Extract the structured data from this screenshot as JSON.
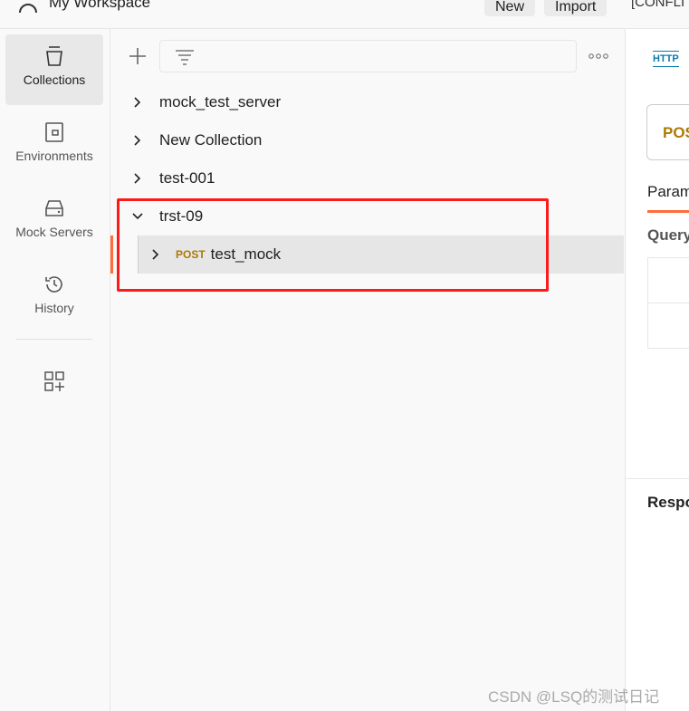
{
  "header": {
    "workspace": "My Workspace",
    "new_label": "New",
    "import_label": "Import",
    "tab_title": "[CONFLI"
  },
  "sidebar": {
    "items": [
      {
        "label": "Collections",
        "icon": "trash-can-collections-icon",
        "selected": true
      },
      {
        "label": "Environments",
        "icon": "environment-icon"
      },
      {
        "label": "Mock Servers",
        "icon": "server-icon"
      },
      {
        "label": "History",
        "icon": "history-icon"
      }
    ],
    "add_icon": "apps-add-icon"
  },
  "tree": {
    "collections": [
      {
        "name": "mock_test_server",
        "expanded": false
      },
      {
        "name": "New Collection",
        "expanded": false
      },
      {
        "name": "test-001",
        "expanded": false
      },
      {
        "name": "trst-09",
        "expanded": true,
        "children": [
          {
            "method": "POST",
            "name": "test_mock"
          }
        ]
      }
    ]
  },
  "request": {
    "http_icon": "HTTP",
    "method": "POS",
    "tab": "Param",
    "query": "Query",
    "response": "Respo"
  },
  "watermark": "CSDN @LSQ的测试日记",
  "colors": {
    "accent": "#ff6c37",
    "post": "#ad7a03",
    "highlight": "#ff0000",
    "http": "#097bab"
  }
}
